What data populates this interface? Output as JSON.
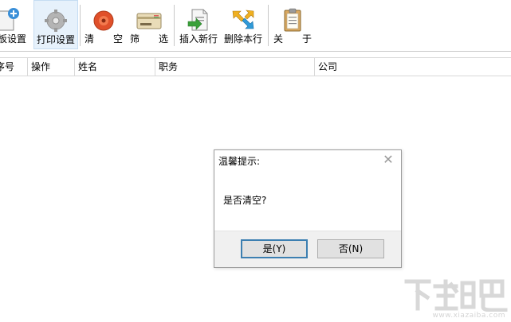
{
  "toolbar": {
    "buttons": [
      {
        "label": "模板设置",
        "icon": "template-add-icon"
      },
      {
        "label": "打印设置",
        "icon": "print-settings-gear-icon"
      },
      {
        "label": "清　　空",
        "icon": "clear-icon"
      },
      {
        "label": "筛　　选",
        "icon": "filter-card-icon"
      },
      {
        "label": "插入新行",
        "icon": "insert-row-icon"
      },
      {
        "label": "删除本行",
        "icon": "delete-row-arrows-icon"
      },
      {
        "label": "关　　于",
        "icon": "about-clipboard-icon"
      }
    ]
  },
  "table": {
    "columns": [
      "序号",
      "操作",
      "姓名",
      "职务",
      "公司"
    ]
  },
  "dialog": {
    "title": "温馨提示:",
    "message": "是否清空?",
    "yes_label": "是(Y)",
    "no_label": "否(N)",
    "close_glyph": "✕"
  },
  "watermark": {
    "url": "www.xiazaiba.com"
  },
  "colors": {
    "active_button_bg": "#e6f1fb",
    "dialog_default_border": "#3c7fb1",
    "clear_icon": "#e0502a"
  }
}
